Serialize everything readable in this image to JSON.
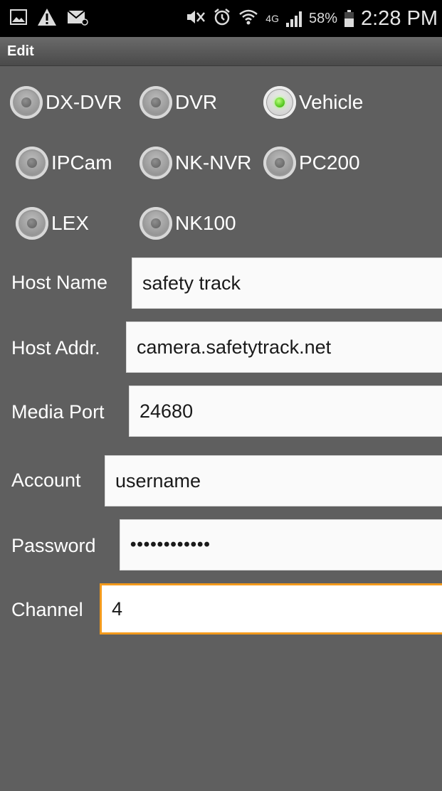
{
  "status_bar": {
    "left_icons": [
      "gallery-icon",
      "warning-icon",
      "email-icon"
    ],
    "right_icons": [
      "mute-icon",
      "alarm-icon",
      "wifi-icon",
      "lte-icon",
      "signal-icon"
    ],
    "network": "4G",
    "battery": "58%",
    "time": "2:28 PM"
  },
  "title": "Edit",
  "device_types": [
    {
      "label": "DX-DVR",
      "checked": false
    },
    {
      "label": "DVR",
      "checked": false
    },
    {
      "label": "Vehicle",
      "checked": true
    },
    {
      "label": "IPCam",
      "checked": false
    },
    {
      "label": "NK-NVR",
      "checked": false
    },
    {
      "label": "PC200",
      "checked": false
    },
    {
      "label": "LEX",
      "checked": false
    },
    {
      "label": "NK100",
      "checked": false
    }
  ],
  "form": {
    "host_name": {
      "label": "Host Name",
      "value": "safety track"
    },
    "host_addr": {
      "label": "Host Addr.",
      "value": "camera.safetytrack.net"
    },
    "media_port": {
      "label": "Media Port",
      "value": "24680"
    },
    "account": {
      "label": "Account",
      "value": "username"
    },
    "password": {
      "label": "Password",
      "value": "••••••••••••"
    },
    "channel": {
      "label": "Channel",
      "value": "4"
    }
  }
}
